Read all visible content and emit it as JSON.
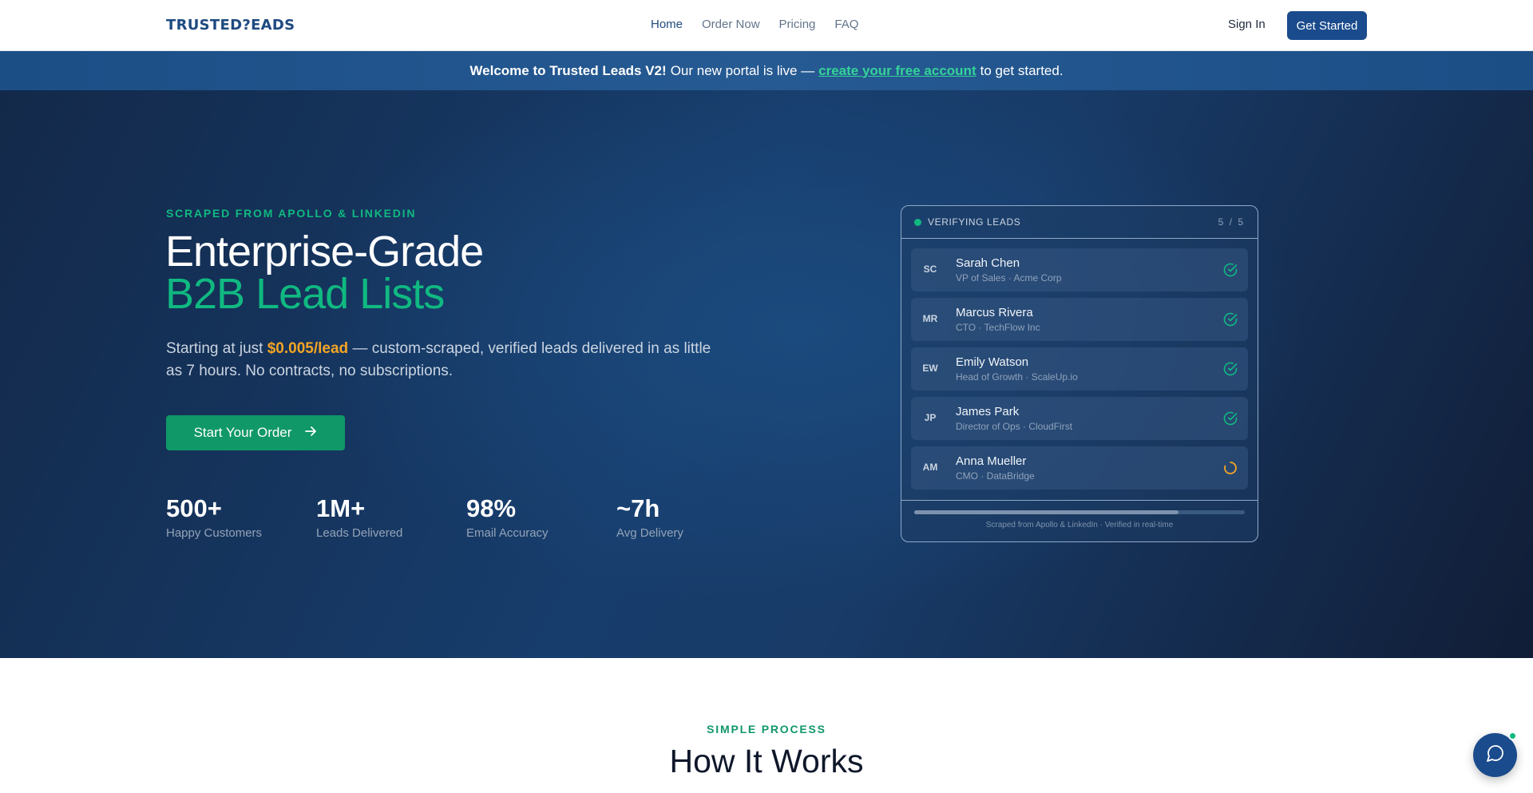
{
  "nav": {
    "logo": "TRUSTED?EADS",
    "links": [
      "Home",
      "Order Now",
      "Pricing",
      "FAQ"
    ],
    "sign_in": "Sign In",
    "get_started": "Get Started"
  },
  "banner": {
    "bold": "Welcome to Trusted Leads V2!",
    "text1": "Our new portal is live —",
    "link": "create your free account",
    "text2": "to get started."
  },
  "hero": {
    "eyebrow": "SCRAPED FROM APOLLO & LINKEDIN",
    "headline1": "Enterprise-Grade",
    "headline2": "B2B Lead Lists",
    "sub_pre": "Starting at just",
    "sub_price": "$0.005/lead",
    "sub_post": "— custom-scraped, verified leads delivered in as little as 7 hours. No contracts, no subscriptions.",
    "cta": "Start Your Order",
    "stats": [
      {
        "num": "500+",
        "label": "Happy Customers"
      },
      {
        "num": "1M+",
        "label": "Leads Delivered"
      },
      {
        "num": "98%",
        "label": "Email Accuracy"
      },
      {
        "num": "~7h",
        "label": "Avg Delivery"
      }
    ]
  },
  "card": {
    "title": "VERIFYING LEADS",
    "count": "5 / 5",
    "leads": [
      {
        "initials": "SC",
        "name": "Sarah Chen",
        "meta": "VP of Sales · Acme Corp",
        "status": "verified"
      },
      {
        "initials": "MR",
        "name": "Marcus Rivera",
        "meta": "CTO · TechFlow Inc",
        "status": "verified"
      },
      {
        "initials": "EW",
        "name": "Emily Watson",
        "meta": "Head of Growth · ScaleUp.io",
        "status": "verified"
      },
      {
        "initials": "JP",
        "name": "James Park",
        "meta": "Director of Ops · CloudFirst",
        "status": "verified"
      },
      {
        "initials": "AM",
        "name": "Anna Mueller",
        "meta": "CMO · DataBridge",
        "status": "loading"
      }
    ],
    "progress": 0.8,
    "footer": "Scraped from Apollo & LinkedIn · Verified in real-time"
  },
  "section": {
    "eyebrow": "SIMPLE PROCESS",
    "title": "How It Works"
  },
  "icons": {
    "chat": "chat-bubble-icon",
    "check": "check-circle-icon",
    "spinner": "spinner-icon",
    "arrow": "arrow-right-icon"
  },
  "colors": {
    "brand": "#1a4b8c",
    "accent": "#10b981",
    "price": "#f5a524"
  }
}
